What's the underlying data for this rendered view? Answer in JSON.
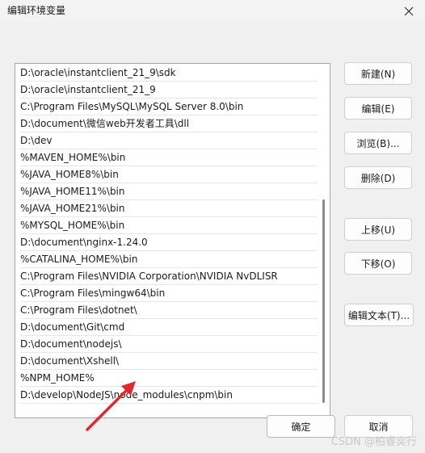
{
  "window": {
    "title": "编辑环境变量"
  },
  "paths": [
    "D:\\oracle\\instantclient_21_9\\sdk",
    "D:\\oracle\\instantclient_21_9",
    "C:\\Program Files\\MySQL\\MySQL Server 8.0\\bin",
    "D:\\document\\微信web开发者工具\\dll",
    "D:\\dev",
    "%MAVEN_HOME%\\bin",
    "%JAVA_HOME8%\\bin",
    "%JAVA_HOME11%\\bin",
    "%JAVA_HOME21%\\bin",
    "%MYSQL_HOME%\\bin",
    "D:\\document\\nginx-1.24.0",
    "%CATALINA_HOME%\\bin",
    "C:\\Program Files\\NVIDIA Corporation\\NVIDIA NvDLISR",
    "C:\\Program Files\\mingw64\\bin",
    "C:\\Program Files\\dotnet\\",
    "D:\\document\\Git\\cmd",
    "D:\\document\\nodejs\\",
    "D:\\document\\Xshell\\",
    "%NPM_HOME%",
    "D:\\develop\\NodeJS\\node_modules\\cnpm\\bin"
  ],
  "buttons": {
    "new": "新建(N)",
    "edit": "编辑(E)",
    "browse": "浏览(B)...",
    "delete": "删除(D)",
    "move_up": "上移(U)",
    "move_down": "下移(O)",
    "edit_text": "编辑文本(T)...",
    "ok": "确定",
    "cancel": "取消"
  },
  "watermark": "CSDN @柏睿奕行",
  "annotation_color": "#e0282e",
  "icons": {
    "close": "close-icon",
    "arrow": "red-arrow-annotation"
  }
}
